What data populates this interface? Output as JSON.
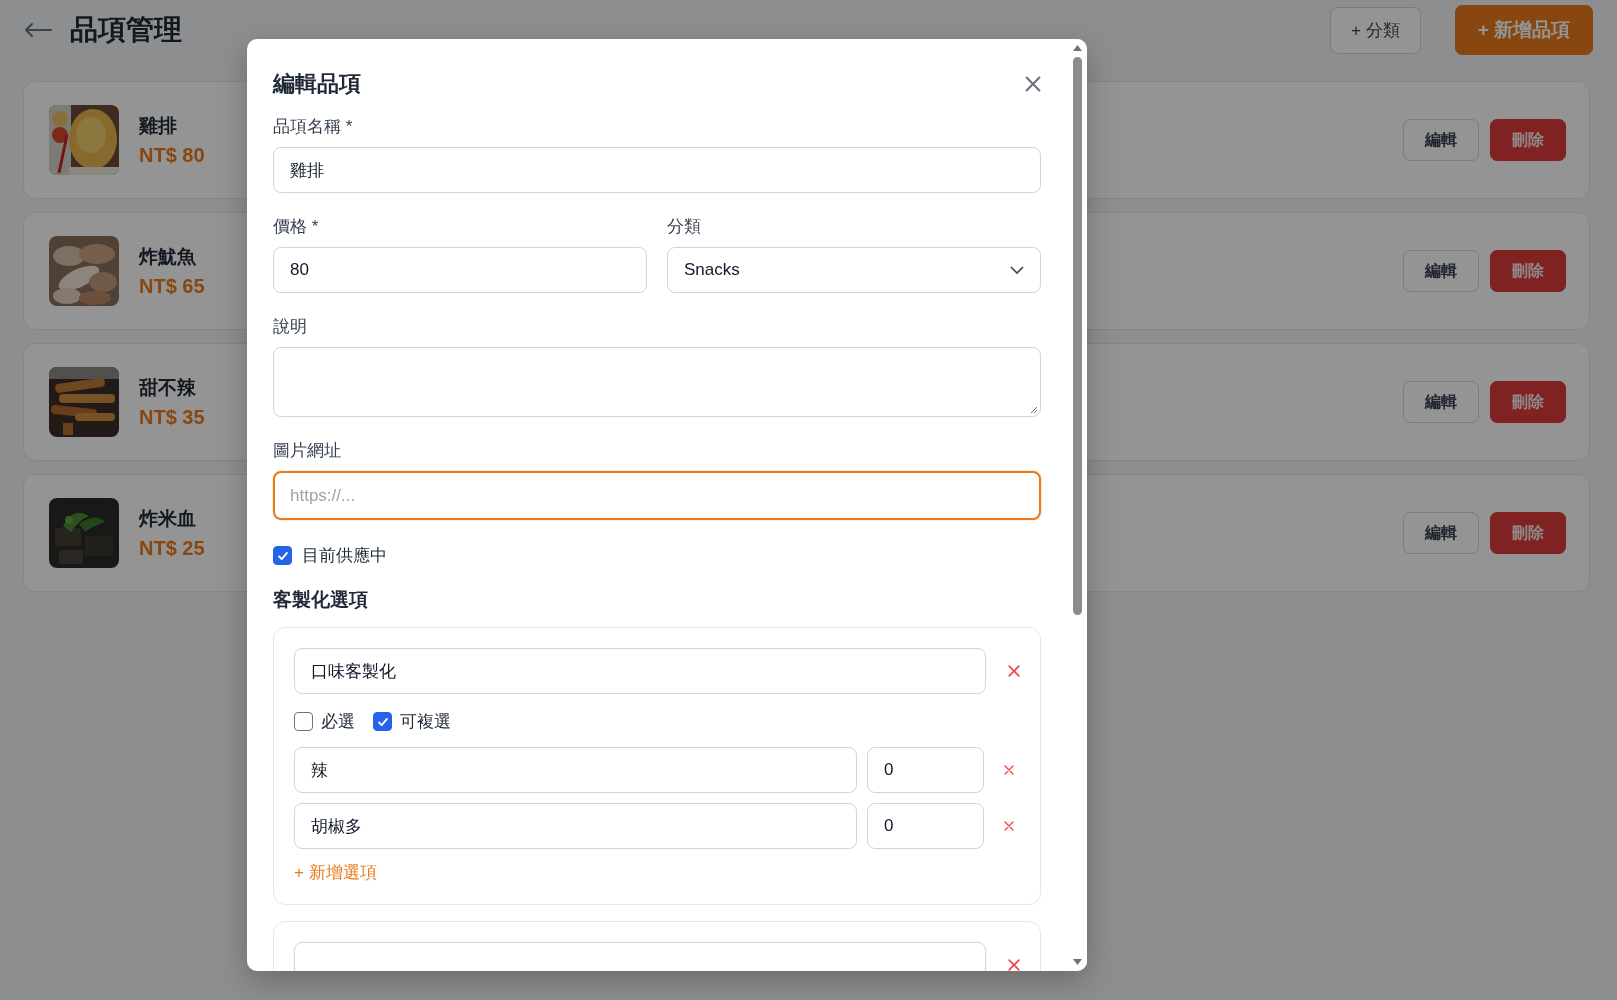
{
  "header": {
    "title": "品項管理",
    "buttons": [
      {
        "label": "+ 分類",
        "kind": "outline"
      },
      {
        "label": "+ 新增品項",
        "kind": "primary"
      }
    ]
  },
  "items": [
    {
      "name": "雞排",
      "price": "NT$ 80",
      "actions": [
        {
          "label": "編輯",
          "kind": "outline"
        },
        {
          "label": "刪除",
          "kind": "danger"
        }
      ]
    },
    {
      "name": "炸魷魚",
      "price": "NT$ 65",
      "actions": [
        {
          "label": "編輯",
          "kind": "outline"
        },
        {
          "label": "刪除",
          "kind": "danger"
        }
      ]
    },
    {
      "name": "甜不辣",
      "price": "NT$ 35",
      "actions": [
        {
          "label": "編輯",
          "kind": "outline"
        },
        {
          "label": "刪除",
          "kind": "danger"
        }
      ]
    },
    {
      "name": "炸米血",
      "price": "NT$ 25",
      "actions": [
        {
          "label": "編輯",
          "kind": "outline"
        },
        {
          "label": "刪除",
          "kind": "danger"
        }
      ]
    }
  ],
  "modal": {
    "title": "編輯品項",
    "name_field": {
      "label": "品項名稱 *",
      "value": "雞排"
    },
    "price_field": {
      "label": "價格 *",
      "value": "80"
    },
    "category_field": {
      "label": "分類",
      "value": "Snacks"
    },
    "description_field": {
      "label": "說明"
    },
    "image_url_field": {
      "label": "圖片網址",
      "placeholder": "https://...",
      "focused": true
    },
    "available": {
      "label": "目前供應中",
      "checked": true
    },
    "customization": {
      "title": "客製化選項",
      "groups": [
        {
          "kind": "group",
          "name": "口味客製化",
          "required": {
            "label": "必選",
            "checked": false
          },
          "multiple": {
            "label": "可複選",
            "checked": true
          },
          "options": [
            {
              "name": "辣",
              "price": "0"
            },
            {
              "name": "胡椒多",
              "price": "0"
            }
          ],
          "add_option": "+ 新增選項"
        },
        {
          "kind": "group"
        }
      ]
    }
  }
}
